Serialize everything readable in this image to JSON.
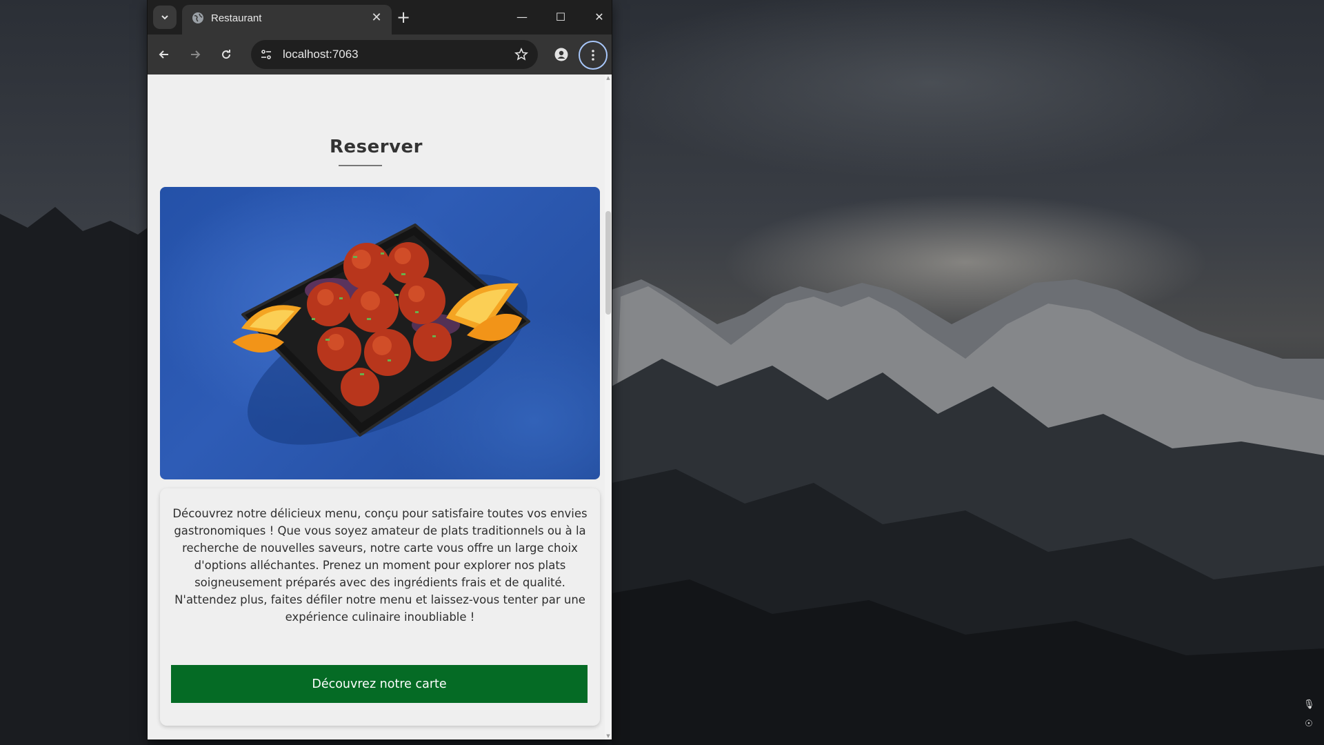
{
  "browser": {
    "tab_title": "Restaurant",
    "url": "localhost:7063"
  },
  "page": {
    "heading": "Reserver",
    "description": "Découvrez notre délicieux menu, conçu pour satisfaire toutes vos envies gastronomiques ! Que vous soyez amateur de plats traditionnels ou à la recherche de nouvelles saveurs, notre carte vous offre un large choix d'options alléchantes. Prenez un moment pour explorer nos plats soigneusement préparés avec des ingrédients frais et de qualité. N'attendez plus, faites défiler notre menu et laissez-vous tenter par une expérience culinaire inoubliable !",
    "cta_label": "Découvrez notre carte"
  },
  "colors": {
    "cta": "#056b25",
    "image_background": "#2a56ac"
  },
  "icons": {
    "tab_search": "chevron-down-icon",
    "favicon": "globe-icon",
    "tab_close": "close-icon",
    "new_tab": "plus-icon",
    "minimize": "minimize-icon",
    "maximize": "maximize-icon",
    "close": "close-icon",
    "back": "arrow-left-icon",
    "forward": "arrow-right-icon",
    "reload": "reload-icon",
    "site_info": "tune-icon",
    "bookmark": "star-icon",
    "profile": "person-icon",
    "menu": "more-vert-icon",
    "mic": "microphone-icon",
    "accessibility": "accessibility-icon"
  }
}
